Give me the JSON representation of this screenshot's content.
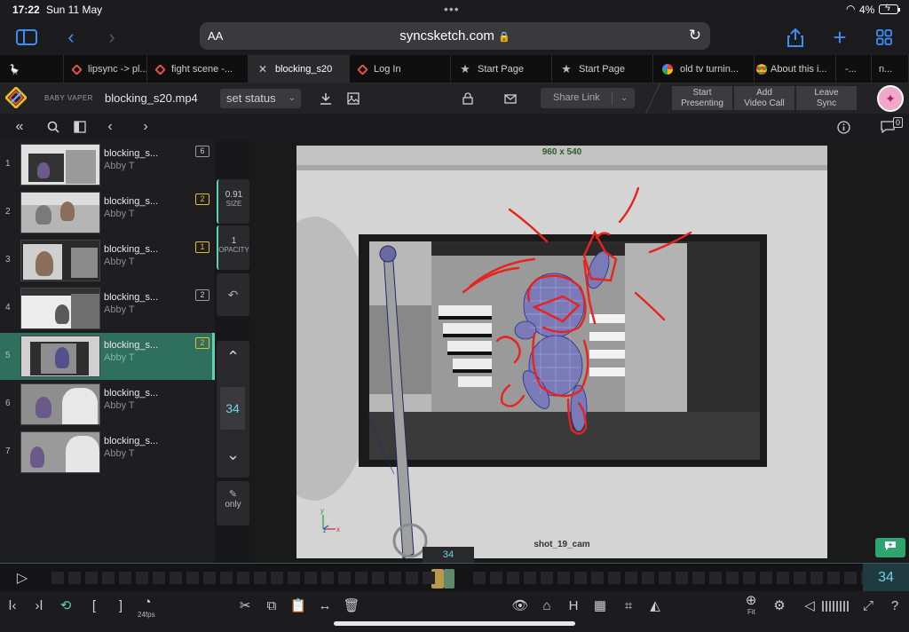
{
  "statusbar": {
    "time": "17:22",
    "date": "Sun 11 May",
    "battery": "4%"
  },
  "browser": {
    "aa": "AA",
    "url": "syncsketch.com",
    "tabs": [
      {
        "label": "lipsync -> pl...",
        "icon": "syncsketch"
      },
      {
        "label": "fight scene -...",
        "icon": "syncsketch"
      },
      {
        "label": "blocking_s20",
        "icon": "close",
        "active": true
      },
      {
        "label": "Log In",
        "icon": "syncsketch"
      },
      {
        "label": "Start Page",
        "icon": "star"
      },
      {
        "label": "Start Page",
        "icon": "star"
      },
      {
        "label": "old tv turnin...",
        "icon": "google"
      },
      {
        "label": "About this i...",
        "icon": "chrome"
      },
      {
        "label": "-...",
        "icon": "none"
      },
      {
        "label": "n...",
        "icon": "none"
      }
    ]
  },
  "header": {
    "project": "BABY VAPER",
    "filename": "blocking_s20.mp4",
    "set_status": "set status",
    "share_link": "Share Link",
    "start_presenting": [
      "Start",
      "Presenting"
    ],
    "add_video_call": [
      "Add",
      "Video Call"
    ],
    "leave_sync": [
      "Leave",
      "Sync"
    ],
    "comment_count": "0"
  },
  "items": [
    {
      "num": "1",
      "name": "blocking_s...",
      "author": "Abby T",
      "comments": "6"
    },
    {
      "num": "2",
      "name": "blocking_s...",
      "author": "Abby T",
      "comments": "2"
    },
    {
      "num": "3",
      "name": "blocking_s...",
      "author": "Abby T",
      "comments": "1"
    },
    {
      "num": "4",
      "name": "blocking_s...",
      "author": "Abby T",
      "comments": "2"
    },
    {
      "num": "5",
      "name": "blocking_s...",
      "author": "Abby T",
      "comments": "2"
    },
    {
      "num": "6",
      "name": "blocking_s...",
      "author": "Abby T",
      "comments": ""
    },
    {
      "num": "7",
      "name": "blocking_s...",
      "author": "Abby T",
      "comments": ""
    }
  ],
  "tools": {
    "size_value": "0.91",
    "size_label": "SIZE",
    "opacity_value": "1",
    "opacity_label": "OPACITY",
    "frame": "34",
    "only_label": "only"
  },
  "viewer": {
    "resolution": "960 x 540",
    "camera": "shot_19_cam",
    "axis_y": "y",
    "axis_z": "z",
    "axis_x": "x"
  },
  "timeline": {
    "current_frame": "34",
    "frame_end_display": "34"
  },
  "bottom": {
    "fps": "24fps",
    "fit": "Fit",
    "h_label": "H",
    "bracket_open": "[",
    "bracket_close": "]"
  },
  "colors": {
    "accent": "#5fd0b0",
    "frame_text": "#6fd3e3",
    "annotation": "#e8231d",
    "active_row": "#2f6f5e"
  }
}
